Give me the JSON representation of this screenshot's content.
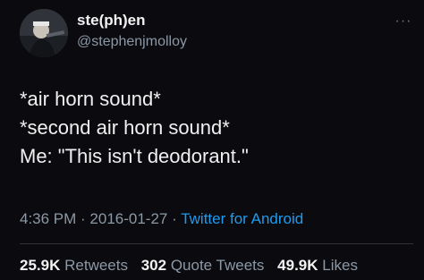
{
  "user": {
    "display_name": "ste(ph)en",
    "handle": "@stephenjmolloy",
    "avatar_icon": "avatar"
  },
  "more_icon": "···",
  "tweet_lines": [
    "*air horn sound*",
    "*second air horn sound*",
    "Me: \"This isn't deodorant.\""
  ],
  "meta": {
    "time": "4:36 PM",
    "sep1": " · ",
    "date": "2016-01-27",
    "sep2": " · ",
    "source": "Twitter for Android"
  },
  "stats": {
    "retweets_count": "25.9K",
    "retweets_label": "Retweets",
    "quotes_count": "302",
    "quotes_label": "Quote Tweets",
    "likes_count": "49.9K",
    "likes_label": "Likes"
  },
  "colors": {
    "background": "#0b0b0f",
    "link": "#1d9bf0",
    "secondary_text": "#8b98a5"
  }
}
